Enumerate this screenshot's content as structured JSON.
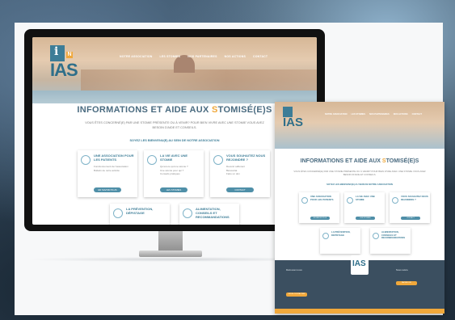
{
  "site": {
    "logo_letter_i": "i",
    "logo_letter_n": "N",
    "logo_text_main": "IAS",
    "nav": [
      "NOTRE ASSOCIATION",
      "LES STOMIES",
      "NOS PARTENAIRES",
      "NOS ACTIONS",
      "CONTACT"
    ],
    "title_pre": "INFORMATIONS ET AIDE AUX ",
    "title_accent": "S",
    "title_post": "TOMISÉ(E)S",
    "intro": "VOUS ÊTES CONCERNÉ(E) PAR UNE STOMIE PRÉSENTE OU À VENIR? POUR BIEN VIVRE AVEC UNE STOMIE VOUS AVEZ BESOIN D'AIDE ET CONSEILS.",
    "intro_strong": "SOYEZ LES BIENVENU(E) AU SEIN DE NOTRE ASSOCIATION",
    "cards": [
      {
        "title": "UNE ASSOCIATION POUR LES PATIENTS",
        "bullets": [
          "Fonctionnement de l'association",
          "Bulletin de notre activité"
        ],
        "button": "EN SAVOIR PLUS",
        "icon": "heart-hands-icon"
      },
      {
        "title": "LA VIE AVEC UNE STOMIE",
        "bullets": [
          "Qu'est-ce qu'une stomie ?",
          "Une stomie pour qui ?",
          "Conseils pratiques"
        ],
        "button": "LES STOMIES",
        "icon": "cycle-icon"
      },
      {
        "title": "VOUS SOUHAITEZ NOUS REJOINDRE ?",
        "bullets": [
          "Devenir adhérent",
          "Bénévolat",
          "Faire un don"
        ],
        "button": "CONTACT",
        "icon": "boxes-icon"
      }
    ],
    "cards2": [
      {
        "title": "LA PRÉVENTION, DÉPISTAGE",
        "icon": "shield-icon"
      },
      {
        "title": "ALIMENTATION, CONSEILS ET RECOMMANDATIONS",
        "icon": "food-icon"
      }
    ]
  },
  "mobile_footer": {
    "col_left_title": "Retrouvez-nous",
    "col_right_title": "Nous suivre",
    "button_left": "NOUS CONTACTER",
    "button_right": "FACEBOOK"
  }
}
